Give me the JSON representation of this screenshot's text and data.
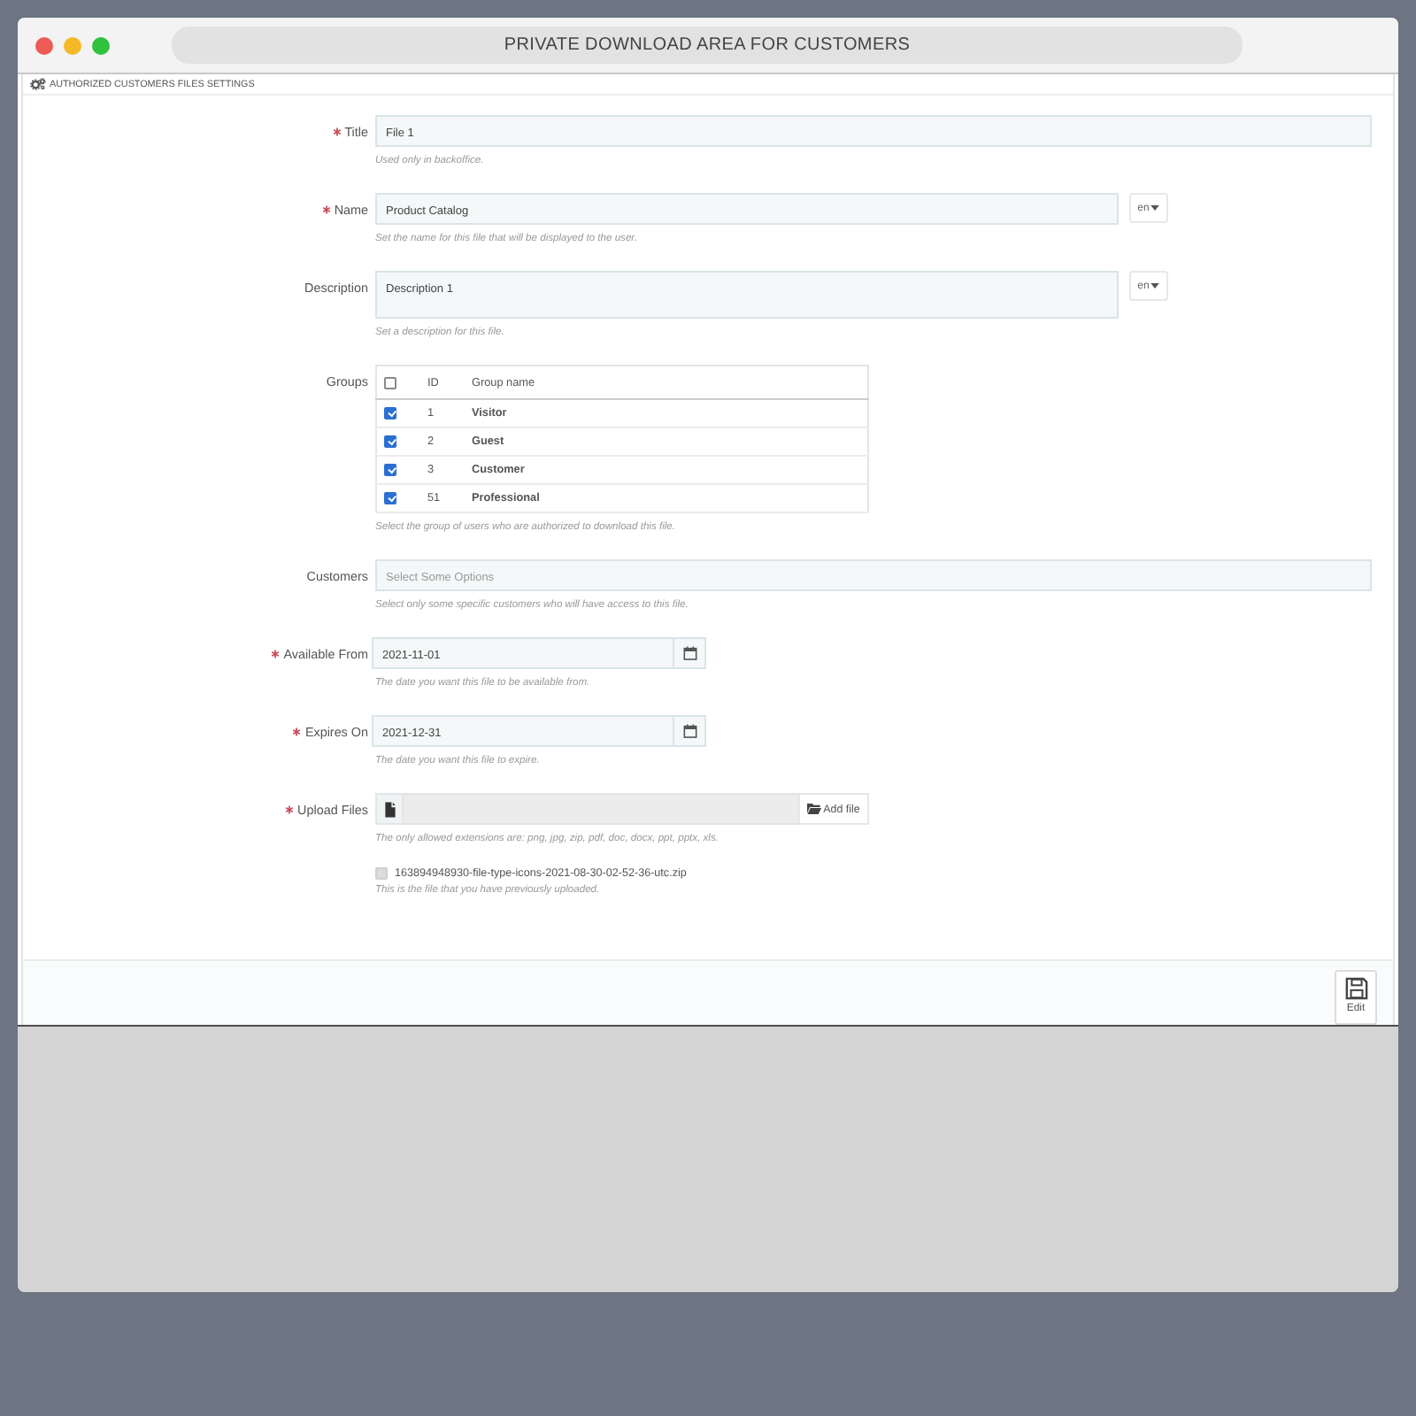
{
  "window": {
    "title": "PRIVATE DOWNLOAD AREA FOR CUSTOMERS"
  },
  "panel": {
    "heading": "AUTHORIZED CUSTOMERS FILES SETTINGS"
  },
  "fields": [
    {
      "kind": "text",
      "label": "Title",
      "required": true,
      "value": "File 1",
      "help": "Used only in backoffice."
    },
    {
      "kind": "text_lang",
      "label": "Name",
      "required": true,
      "value": "Product Catalog",
      "language": "en",
      "help": "Set the name for this file that will be displayed to the user."
    },
    {
      "kind": "textarea_lang",
      "label": "Description",
      "required": false,
      "value": "Description 1",
      "language": "en",
      "help": "Set a description for this file."
    },
    {
      "kind": "groups",
      "label": "Groups",
      "required": false,
      "all_checked": false,
      "columns": [
        "ID",
        "Group name"
      ],
      "rows": [
        {
          "id": "1",
          "name": "Visitor",
          "checked": true
        },
        {
          "id": "2",
          "name": "Guest",
          "checked": true
        },
        {
          "id": "3",
          "name": "Customer",
          "checked": true
        },
        {
          "id": "51",
          "name": "Professional",
          "checked": true
        }
      ],
      "help": "Select the group of users who are authorized to download this file."
    },
    {
      "kind": "multiselect",
      "label": "Customers",
      "required": false,
      "placeholder": "Select Some Options",
      "help": "Select only some specific customers who will have access to this file."
    },
    {
      "kind": "date",
      "label": "Available From",
      "required": true,
      "value": "2021-11-01",
      "help": "The date you want this file to be available from."
    },
    {
      "kind": "date",
      "label": "Expires On",
      "required": true,
      "value": "2021-12-31",
      "help": "The date you want this file to expire."
    },
    {
      "kind": "file",
      "label": "Upload Files",
      "required": true,
      "button": "Add file",
      "help": "The only allowed extensions are: png, jpg, zip, pdf, doc, docx, ppt, pptx, xls."
    },
    {
      "kind": "uploaded",
      "file_name": "163894948930-file-type-icons-2021-08-30-02-52-36-utc.zip",
      "checked": false,
      "disabled": true,
      "help": "This is the file that you have previously uploaded."
    }
  ],
  "footer": {
    "button": "Edit"
  }
}
